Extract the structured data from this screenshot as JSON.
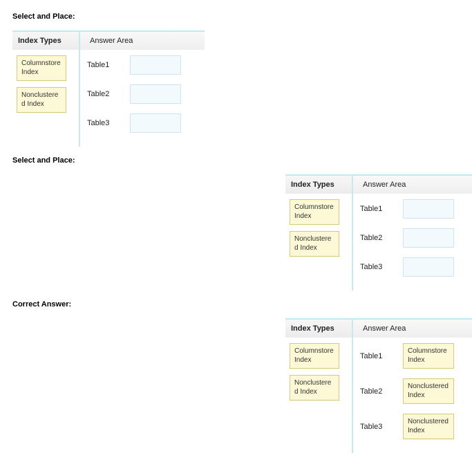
{
  "sections": [
    {
      "title": "Select and Place:",
      "header_left": "Index Types",
      "header_right": "Answer Area",
      "sources": [
        "Columnstore Index",
        "Nonclustered Index"
      ],
      "rows": [
        {
          "label": "Table1",
          "filled": false,
          "answer": ""
        },
        {
          "label": "Table2",
          "filled": false,
          "answer": ""
        },
        {
          "label": "Table3",
          "filled": false,
          "answer": ""
        }
      ],
      "align": "left"
    },
    {
      "title": "Select and Place:",
      "header_left": "Index Types",
      "header_right": "Answer Area",
      "sources": [
        "Columnstore Index",
        "Nonclustered Index"
      ],
      "rows": [
        {
          "label": "Table1",
          "filled": false,
          "answer": ""
        },
        {
          "label": "Table2",
          "filled": false,
          "answer": ""
        },
        {
          "label": "Table3",
          "filled": false,
          "answer": ""
        }
      ],
      "align": "right"
    },
    {
      "title": "Correct Answer:",
      "header_left": "Index Types",
      "header_right": "Answer Area",
      "sources": [
        "Columnstore Index",
        "Nonclustered Index"
      ],
      "rows": [
        {
          "label": "Table1",
          "filled": true,
          "answer": "Columnstore Index"
        },
        {
          "label": "Table2",
          "filled": true,
          "answer": "Nonclustered Index"
        },
        {
          "label": "Table3",
          "filled": true,
          "answer": "Nonclustered Index"
        }
      ],
      "align": "right"
    }
  ]
}
